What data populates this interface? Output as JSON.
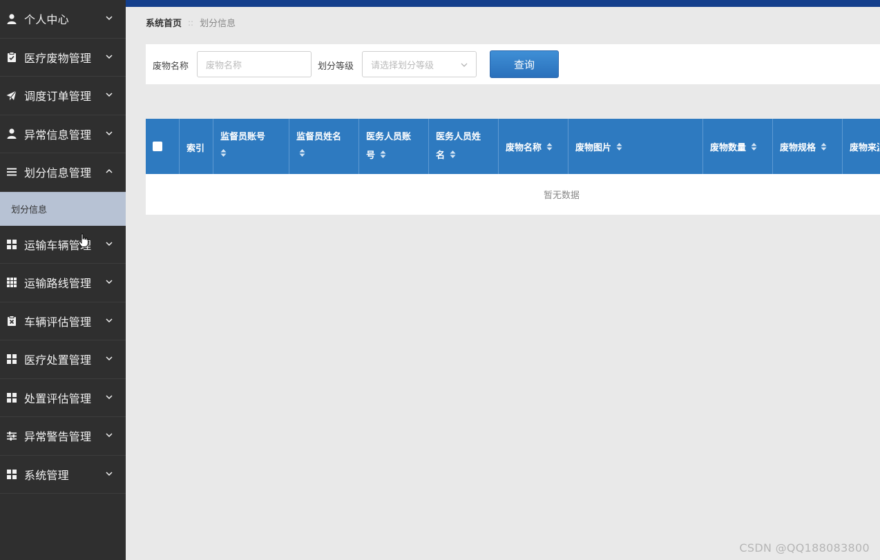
{
  "sidebar": {
    "items": [
      {
        "label": "个人中心",
        "icon": "user-icon",
        "expanded": false
      },
      {
        "label": "医疗废物管理",
        "icon": "clipboard-icon",
        "expanded": false
      },
      {
        "label": "调度订单管理",
        "icon": "paper-plane-icon",
        "expanded": false
      },
      {
        "label": "异常信息管理",
        "icon": "user-icon",
        "expanded": false
      },
      {
        "label": "划分信息管理",
        "icon": "list-icon",
        "expanded": true
      },
      {
        "label": "运输车辆管理",
        "icon": "grid-icon",
        "expanded": false
      },
      {
        "label": "运输路线管理",
        "icon": "grid-icon",
        "expanded": false
      },
      {
        "label": "车辆评估管理",
        "icon": "clipboard-x-icon",
        "expanded": false
      },
      {
        "label": "医疗处置管理",
        "icon": "grid-icon",
        "expanded": false
      },
      {
        "label": "处置评估管理",
        "icon": "grid-icon",
        "expanded": false
      },
      {
        "label": "异常警告管理",
        "icon": "sliders-icon",
        "expanded": false
      },
      {
        "label": "系统管理",
        "icon": "grid-icon",
        "expanded": false
      }
    ],
    "submenu": {
      "label": "划分信息"
    }
  },
  "breadcrumb": {
    "home": "系统首页",
    "separator": "::",
    "current": "划分信息"
  },
  "search": {
    "name_label": "废物名称",
    "name_placeholder": "废物名称",
    "level_label": "划分等级",
    "level_placeholder": "请选择划分等级",
    "query_button": "查询"
  },
  "table": {
    "columns": [
      {
        "label": "",
        "type": "checkbox",
        "sortable": false
      },
      {
        "label": "索引",
        "sortable": false
      },
      {
        "label_line1": "监督员账号",
        "label_line2": "",
        "sortable": true
      },
      {
        "label_line1": "监督员姓名",
        "label_line2": "",
        "sortable": true
      },
      {
        "label_line1": "医务人员账",
        "label_line2": "号",
        "sortable": true
      },
      {
        "label_line1": "医务人员姓",
        "label_line2": "名",
        "sortable": true
      },
      {
        "label": "废物名称",
        "sortable": true
      },
      {
        "label": "废物图片",
        "sortable": true
      },
      {
        "label": "废物数量",
        "sortable": true
      },
      {
        "label": "废物规格",
        "sortable": true
      },
      {
        "label": "废物来源",
        "sortable": true
      }
    ],
    "empty_text": "暂无数据"
  },
  "watermark": "CSDN @QQ188083800",
  "colors": {
    "sidebar_bg": "#2f2f2f",
    "submenu_active_bg": "#b7c2d4",
    "topbar": "#143f8c",
    "table_header": "#2e7ac0",
    "query_button": "#2f7bc6"
  }
}
